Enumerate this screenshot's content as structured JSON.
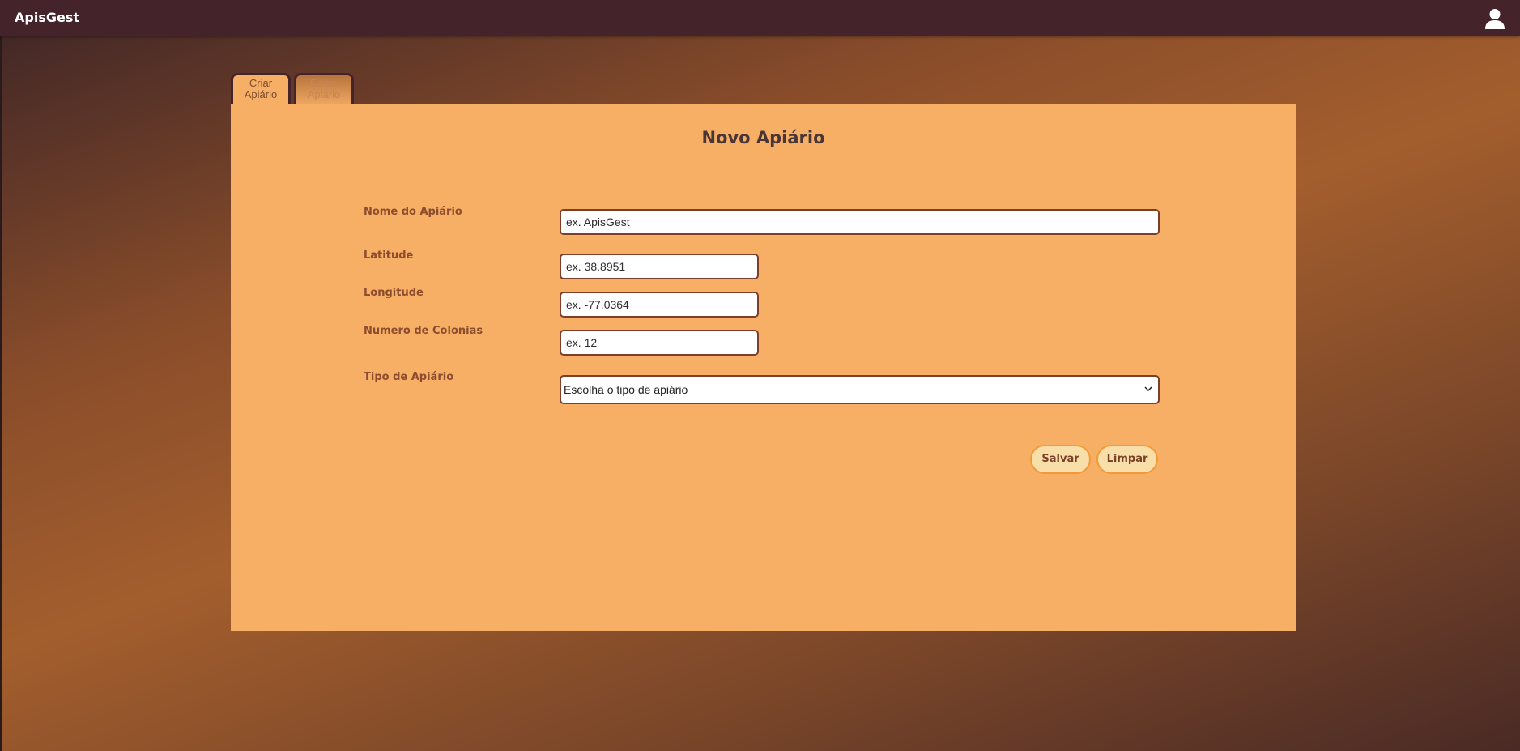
{
  "app": {
    "title": "ApisGest"
  },
  "header": {
    "user_icon": "user-icon"
  },
  "tabs": [
    {
      "line1": "Criar",
      "line2": "Apiário",
      "active": true
    },
    {
      "line1": "Editar",
      "line2": "Apiário",
      "active": false
    }
  ],
  "form": {
    "title": "Novo Apiário",
    "fields": {
      "nome": {
        "label": "Nome do Apiário",
        "placeholder": "ex. ApisGest",
        "value": ""
      },
      "latitude": {
        "label": "Latitude",
        "placeholder": "ex. 38.8951",
        "value": ""
      },
      "longitude": {
        "label": "Longitude",
        "placeholder": "ex. -77.0364",
        "value": ""
      },
      "colonias": {
        "label": "Numero de Colonias",
        "placeholder": "ex. 12",
        "value": ""
      },
      "tipo": {
        "label": "Tipo de Apiário",
        "selected": "Escolha o tipo de apiário"
      }
    },
    "buttons": {
      "save": "Salvar",
      "clear": "Limpar"
    }
  },
  "colors": {
    "topbar": "#44242a",
    "panel": "#f7ae65",
    "label": "#8d4c2e",
    "button_bg": "#f8dfaa",
    "button_border": "#f29a38"
  }
}
